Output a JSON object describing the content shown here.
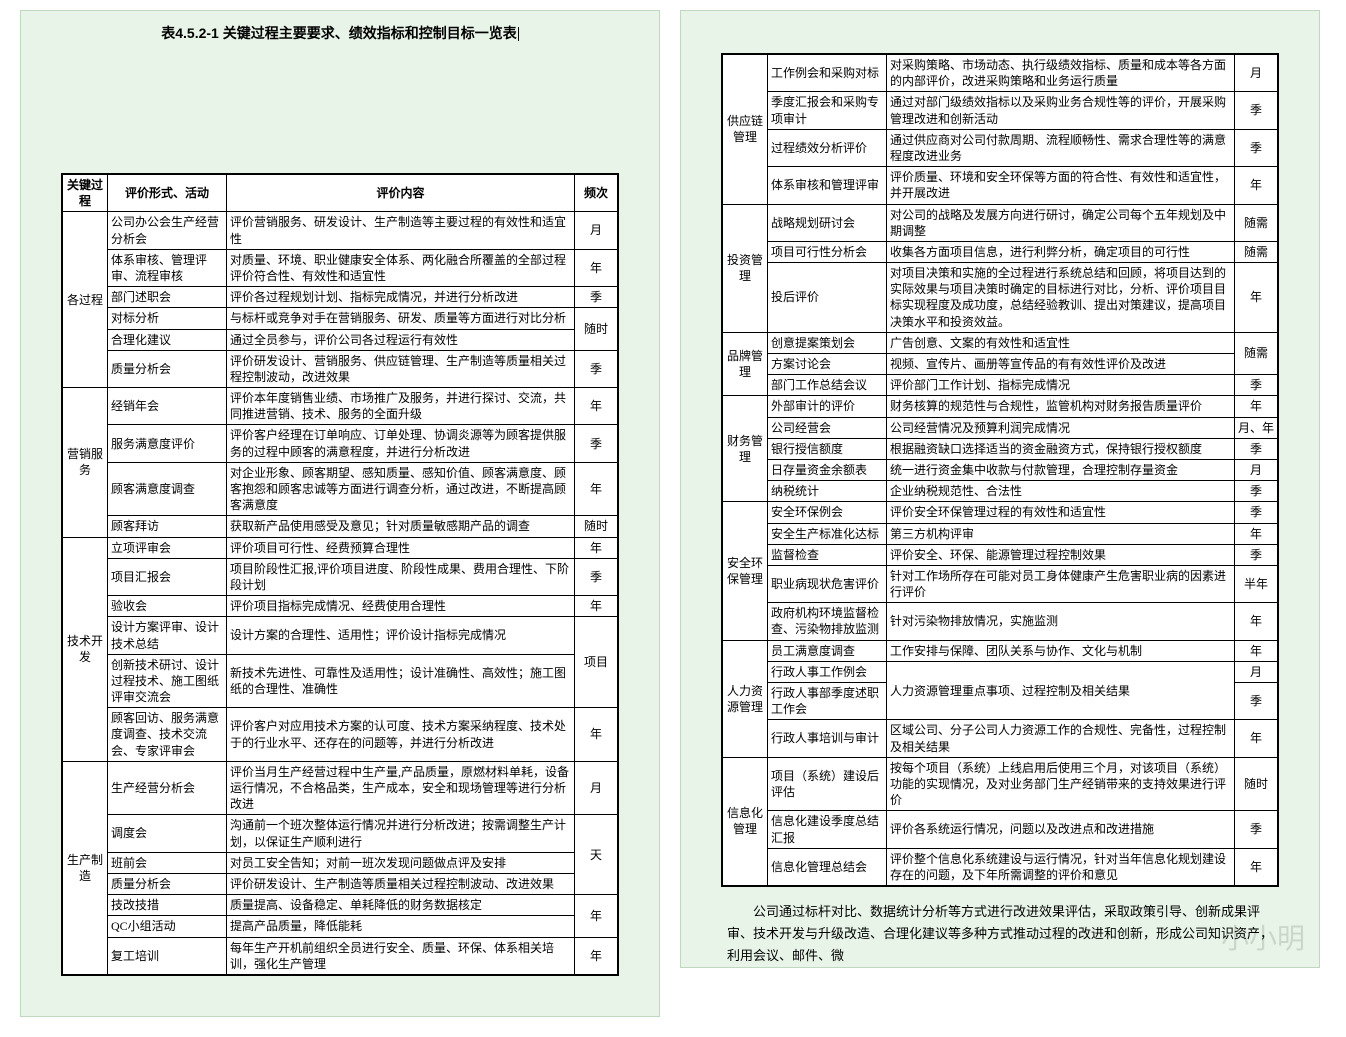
{
  "title": "表4.5.2-1 关键过程主要要求、绩效指标和控制目标一览表",
  "headers": {
    "process": "关键过程",
    "form": "评价形式、活动",
    "content": "评价内容",
    "freq": "频次"
  },
  "left": {
    "groups": [
      {
        "process": "各过程",
        "rows": [
          {
            "form": "公司办公会生产经营分析会",
            "content": "评价营销服务、研发设计、生产制造等主要过程的有效性和适宜性",
            "freq": "月"
          },
          {
            "form": "体系审核、管理评审、流程审核",
            "content": "对质量、环境、职业健康安全体系、两化融合所覆盖的全部过程评价符合性、有效性和适宜性",
            "freq": "年"
          },
          {
            "form": "部门述职会",
            "content": "评价各过程规划计划、指标完成情况，并进行分析改进",
            "freq": "季"
          },
          {
            "form": "对标分析",
            "content": "与标杆或竞争对手在营销服务、研发、质量等方面进行对比分析",
            "freq": "随时"
          },
          {
            "form": "合理化建议",
            "content": "通过全员参与，评价公司各过程运行有效性",
            "freq": ""
          },
          {
            "form": "质量分析会",
            "content": "评价研发设计、营销服务、供应链管理、生产制造等质量相关过程控制波动，改进效果",
            "freq": "季"
          }
        ]
      },
      {
        "process": "营销服务",
        "rows": [
          {
            "form": "经销年会",
            "content": "评价本年度销售业绩、市场推广及服务，并进行探讨、交流，共同推进营销、技术、服务的全面升级",
            "freq": "年"
          },
          {
            "form": "服务满意度评价",
            "content": "评价客户经理在订单响应、订单处理、协调炎源等为顾客提供服务的过程中顾客的满意程度，并进行分析改进",
            "freq": "季"
          },
          {
            "form": "顾客满意度调查",
            "content": "对企业形象、顾客期望、感知质量、感知价值、顾客满意度、顾客抱怨和顾客忠诚等方面进行调查分析，通过改进，不断提高顾客满意度",
            "freq": "年"
          },
          {
            "form": "顾客拜访",
            "content": "获取新产品使用感受及意见；针对质量敏感期产品的调查",
            "freq": "随时"
          }
        ]
      },
      {
        "process": "技术开发",
        "rows": [
          {
            "form": "立项评审会",
            "content": "评价项目可行性、经费预算合理性",
            "freq": "年"
          },
          {
            "form": "项目汇报会",
            "content": "项目阶段性汇报,评价项目进度、阶段性成果、费用合理性、下阶段计划",
            "freq": "季"
          },
          {
            "form": "验收会",
            "content": "评价项目指标完成情况、经费使用合理性",
            "freq": "年"
          },
          {
            "form": "设计方案评审、设计技术总结",
            "content": "设计方案的合理性、适用性；评价设计指标完成情况",
            "freq": "项目"
          },
          {
            "form": "创新技术研讨、设计过程技术、施工图纸评审交流会",
            "content": "新技术先进性、可靠性及适用性；设计准确性、高效性；施工图纸的合理性、准确性",
            "freq": ""
          },
          {
            "form": "顾客回访、服务满意度调查、技术交流会、专家评审会",
            "content": "评价客户对应用技术方案的认可度、技术方案采纳程度、技术处于的行业水平、还存在的问题等，并进行分析改进",
            "freq": "年"
          }
        ]
      },
      {
        "process": "生产制造",
        "rows": [
          {
            "form": "生产经营分析会",
            "content": "评价当月生产经营过程中生产量,产品质量，原燃材料单耗，设备运行情况，不合格品类，生产成本，安全和现场管理等进行分析改进",
            "freq": "月"
          },
          {
            "form": "调度会",
            "content": "沟通前一个班次整体运行情况并进行分析改进；按需调整生产计划，以保证生产顺利进行",
            "freq": "天"
          },
          {
            "form": "班前会",
            "content": "对员工安全告知；对前一班次发现问题做点评及安排",
            "freq": ""
          },
          {
            "form": "质量分析会",
            "content": "评价研发设计、生产制造等质量相关过程控制波动、改进效果",
            "freq": ""
          },
          {
            "form": "技改技措",
            "content": "质量提高、设备稳定、单耗降低的财务数据核定",
            "freq": "年"
          },
          {
            "form": "QC小组活动",
            "content": "提高产品质量，降低能耗",
            "freq": ""
          },
          {
            "form": "复工培训",
            "content": "每年生产开机前组织全员进行安全、质量、环保、体系相关培训，强化生产管理",
            "freq": "年"
          }
        ]
      }
    ]
  },
  "right": {
    "groups": [
      {
        "process": "供应链管理",
        "rows": [
          {
            "form": "工作例会和采购对标",
            "content": "对采购策略、市场动态、执行级绩效指标、质量和成本等各方面的内部评价，改进采购策略和业务运行质量",
            "freq": "月"
          },
          {
            "form": "季度汇报会和采购专项审计",
            "content": "通过对部门级绩效指标以及采购业务合规性等的评价，开展采购管理改进和创新活动",
            "freq": "季"
          },
          {
            "form": "过程绩效分析评价",
            "content": "通过供应商对公司付款周期、流程顺畅性、需求合理性等的满意程度改进业务",
            "freq": "季"
          },
          {
            "form": "体系审核和管理评审",
            "content": "评价质量、环境和安全环保等方面的符合性、有效性和适宜性，并开展改进",
            "freq": "年"
          }
        ]
      },
      {
        "process": "投资管理",
        "rows": [
          {
            "form": "战略规划研讨会",
            "content": "对公司的战略及发展方向进行研讨，确定公司每个五年规划及中期调整",
            "freq": "随需"
          },
          {
            "form": "项目可行性分析会",
            "content": "收集各方面项目信息，进行利弊分析，确定项目的可行性",
            "freq": "随需"
          },
          {
            "form": "投后评价",
            "content": "对项目决策和实施的全过程进行系统总结和回顾，将项目达到的实际效果与项目决策时确定的目标进行对比，分析、评价项目目标实现程度及成功度，总结经验教训、提出对策建议，提高项目决策水平和投资效益。",
            "freq": "年"
          }
        ]
      },
      {
        "process": "品牌管理",
        "rows": [
          {
            "form": "创意提案策划会",
            "content": "广告创意、文案的有效性和适宜性",
            "freq": "随需"
          },
          {
            "form": "方案讨论会",
            "content": "视频、宣传片、画册等宣传品的有有效性评价及改进",
            "freq": ""
          },
          {
            "form": "部门工作总结会议",
            "content": "评价部门工作计划、指标完成情况",
            "freq": "季"
          }
        ]
      },
      {
        "process": "财务管理",
        "rows": [
          {
            "form": "外部审计的评价",
            "content": "财务核算的规范性与合规性，监管机构对财务报告质量评价",
            "freq": "年"
          },
          {
            "form": "公司经营会",
            "content": "公司经营情况及预算利润完成情况",
            "freq": "月、年"
          },
          {
            "form": "银行授信额度",
            "content": "根据融资缺口选择适当的资金融资方式，保持银行授权额度",
            "freq": "季"
          },
          {
            "form": "日存量资金余额表",
            "content": "统一进行资金集中收款与付款管理，合理控制存量资金",
            "freq": "月"
          },
          {
            "form": "纳税统计",
            "content": "企业纳税规范性、合法性",
            "freq": "季"
          }
        ]
      },
      {
        "process": "安全环保管理",
        "rows": [
          {
            "form": "安全环保例会",
            "content": "评价安全环保管理过程的有效性和适宜性",
            "freq": "季"
          },
          {
            "form": "安全生产标准化达标",
            "content": "第三方机构评审",
            "freq": "年"
          },
          {
            "form": "监督检查",
            "content": "评价安全、环保、能源管理过程控制效果",
            "freq": "季"
          },
          {
            "form": "职业病现状危害评价",
            "content": "针对工作场所存在可能对员工身体健康产生危害职业病的因素进行评价",
            "freq": "半年"
          },
          {
            "form": "政府机构环境监督检查、污染物排放监测",
            "content": "针对污染物排放情况，实施监测",
            "freq": "年"
          }
        ]
      },
      {
        "process": "人力资源管理",
        "rows": [
          {
            "form": "员工满意度调查",
            "content": "工作安排与保障、团队关系与协作、文化与机制",
            "freq": "年"
          },
          {
            "form": "行政人事工作例会",
            "content": "人力资源管理重点事项、过程控制及相关结果",
            "freq": "月"
          },
          {
            "form": "行政人事部季度述职工作会",
            "content": "",
            "freq": "季"
          },
          {
            "form": "行政人事培训与审计",
            "content": "区域公司、分子公司人力资源工作的合规性、完备性，过程控制及相关结果",
            "freq": "年"
          }
        ]
      },
      {
        "process": "信息化管理",
        "rows": [
          {
            "form": "项目（系统）建设后评估",
            "content": "按每个项目（系统）上线启用后使用三个月，对该项目（系统）功能的实现情况，及对业务部门生产经销带来的支持效果进行评价",
            "freq": "随时"
          },
          {
            "form": "信息化建设季度总结汇报",
            "content": "评价各系统运行情况，问题以及改进点和改进措施",
            "freq": "季"
          },
          {
            "form": "信息化管理总结会",
            "content": "评价整个信息化系统建设与运行情况，针对当年信息化规划建设存在的问题，及下年所需调整的评价和意见",
            "freq": "年"
          }
        ]
      }
    ]
  },
  "paragraph": "公司通过标杆对比、数据统计分析等方式进行改进效果评估，采取政策引导、创新成果评审、技术开发与升级改造、合理化建议等多种方式推动过程的改进和创新，形成公司知识资产，利用会议、邮件、微",
  "watermark": "小小明"
}
